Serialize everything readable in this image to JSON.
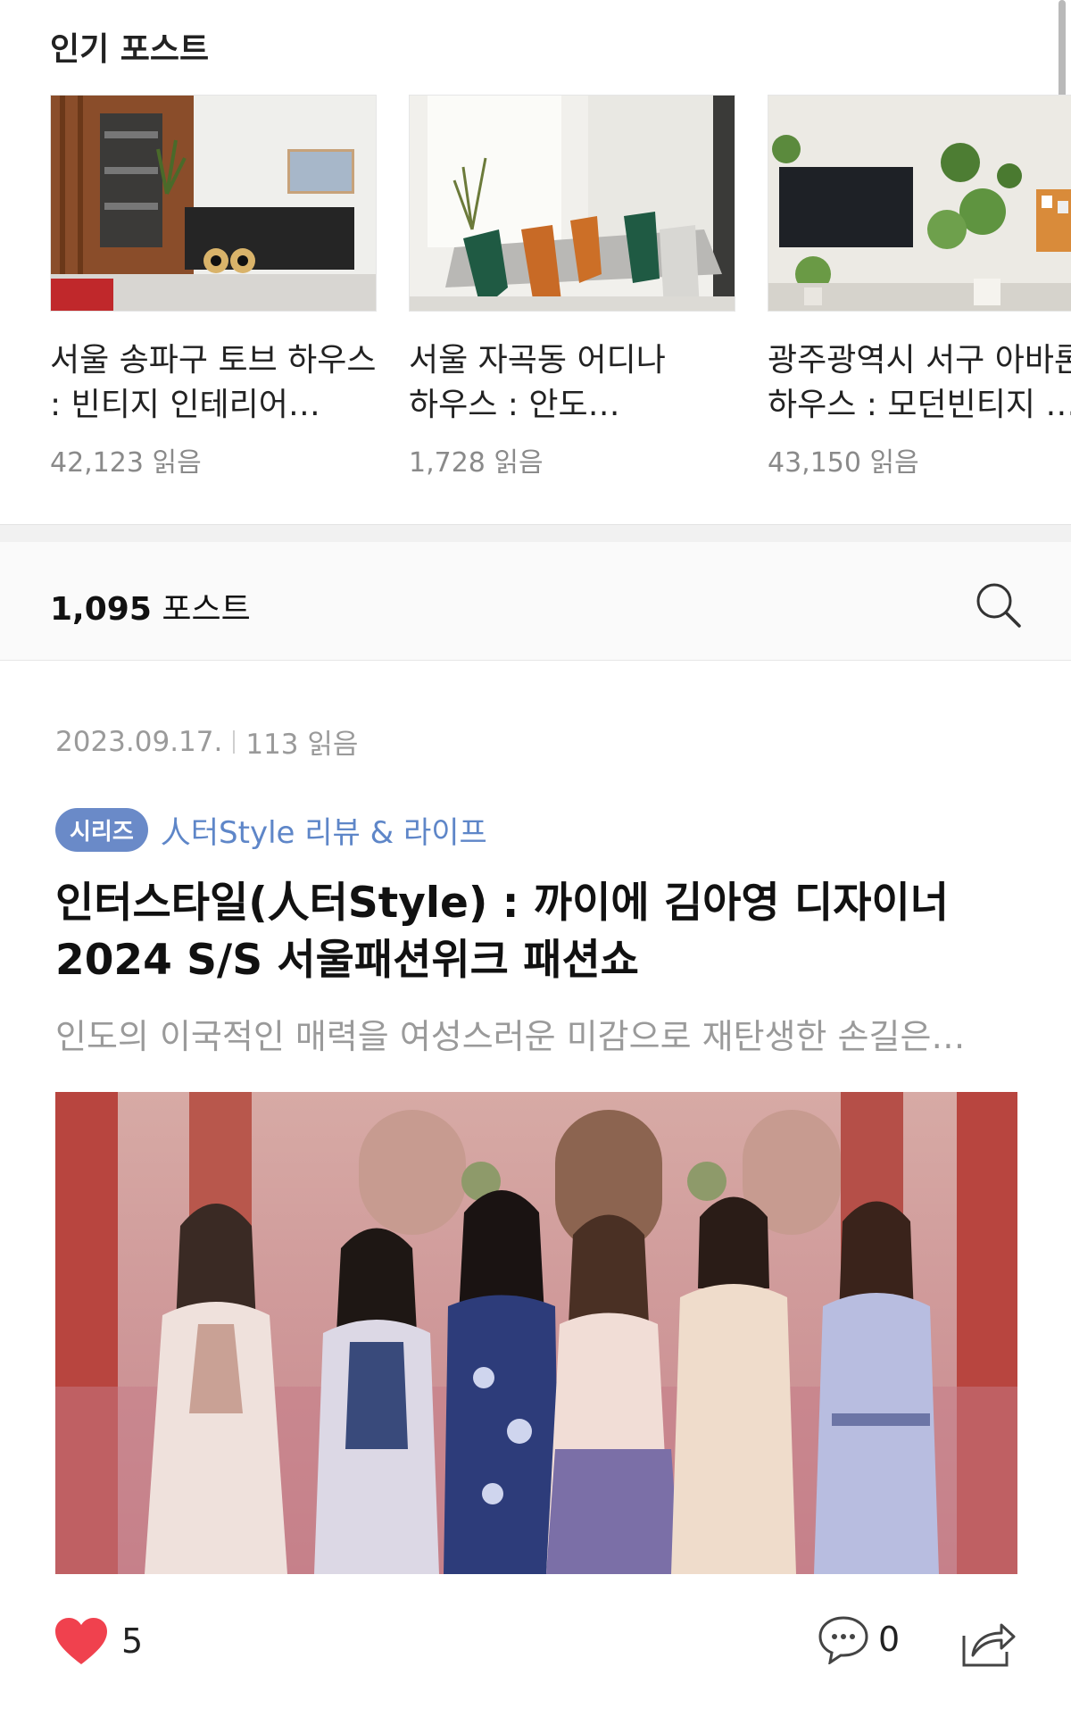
{
  "popular": {
    "title": "인기 포스트",
    "cards": [
      {
        "title": "서울 송파구 토브 하우스 : 빈티지 인테리어…",
        "reads": "42,123 읽음",
        "image": "living-room-speakers-image"
      },
      {
        "title": "서울 자곡동 어디나 하우스 : 안도 다다오의…",
        "reads": "1,728 읽음",
        "image": "dining-room-image"
      },
      {
        "title": "광주광역시 서구 아바론 하우스 : 모던빈티지 …",
        "reads": "43,150 읽음",
        "image": "plants-tv-room-image"
      }
    ]
  },
  "posts_bar": {
    "count": "1,095",
    "label": "포스트",
    "search_icon": "search-icon"
  },
  "article": {
    "date": "2023.09.17.",
    "reads": "113 읽음",
    "series_badge": "시리즈",
    "series_name": "人터Style 리뷰 & 라이프",
    "headline": "인터스타일(人터Style) : 까이에 김아영 디자이너 2024 S/S 서울패션위크 패션쇼",
    "summary": "인도의 이국적인 매력을 여성스러운 미감으로 재탄생한 손길은…",
    "image": "group-photo-six-women"
  },
  "actions": {
    "likes": "5",
    "comments": "0"
  },
  "colors": {
    "accent": "#6a8ac8",
    "heart": "#f0414e"
  }
}
